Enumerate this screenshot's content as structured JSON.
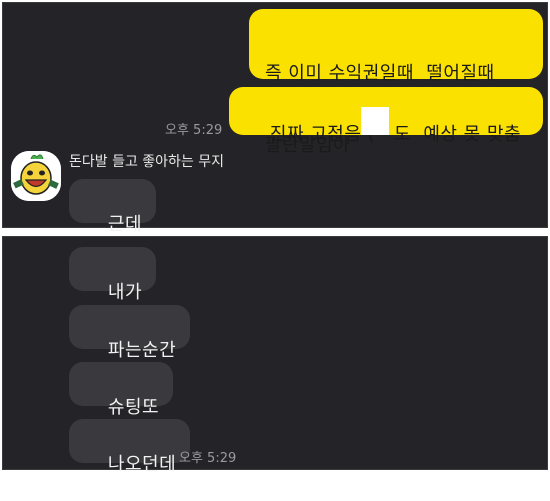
{
  "top_panel": {
    "sent_messages": [
      {
        "line1": "즉 이미 수익권일때  떨어질때",
        "line2": "팔란말임아"
      },
      {
        "text": "진짜 고점음 (   도  예상 못 맞춤"
      }
    ],
    "sent_time": "오후 5:29",
    "sender_name": "돈다발 들고 좋아하는 무지",
    "received_messages": [
      "근데"
    ]
  },
  "bottom_panel": {
    "received_messages": [
      "내가",
      "파는순간",
      "슈팅또",
      "나오던데"
    ],
    "received_time": "오후 5:29"
  },
  "colors": {
    "background": "#242428",
    "sent_bubble": "#fae100",
    "received_bubble": "#3a3a3e",
    "timestamp": "#9a9a9e"
  },
  "icons": {
    "avatar": "muzi-emoticon-avatar"
  }
}
